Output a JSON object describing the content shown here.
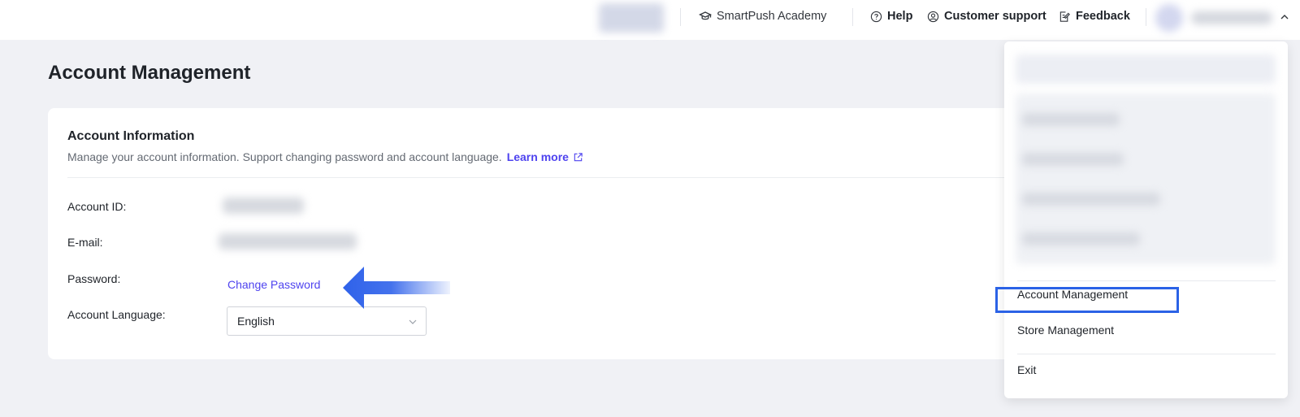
{
  "topbar": {
    "academy_label": "SmartPush Academy",
    "help_label": "Help",
    "support_label": "Customer support",
    "feedback_label": "Feedback",
    "icons": [
      "graduation-cap-icon",
      "question-circle-icon",
      "headset-icon",
      "feedback-edit-icon",
      "chevron-up-icon"
    ]
  },
  "page": {
    "title": "Account Management"
  },
  "account_info": {
    "title": "Account Information",
    "description": "Manage your account information. Support changing password and account language.",
    "learn_more": "Learn more",
    "rows": {
      "account_id_label": "Account ID:",
      "email_label": "E-mail:",
      "password_label": "Password:",
      "language_label": "Account Language:"
    },
    "change_password": "Change Password",
    "language_value": "English"
  },
  "dropdown": {
    "account_management": "Account Management",
    "store_management": "Store Management",
    "exit": "Exit"
  },
  "colors": {
    "accent": "#4e43ef",
    "highlight_border": "#2b62e6",
    "arrow": "#2f62ea",
    "page_bg": "#f0f1f5"
  }
}
